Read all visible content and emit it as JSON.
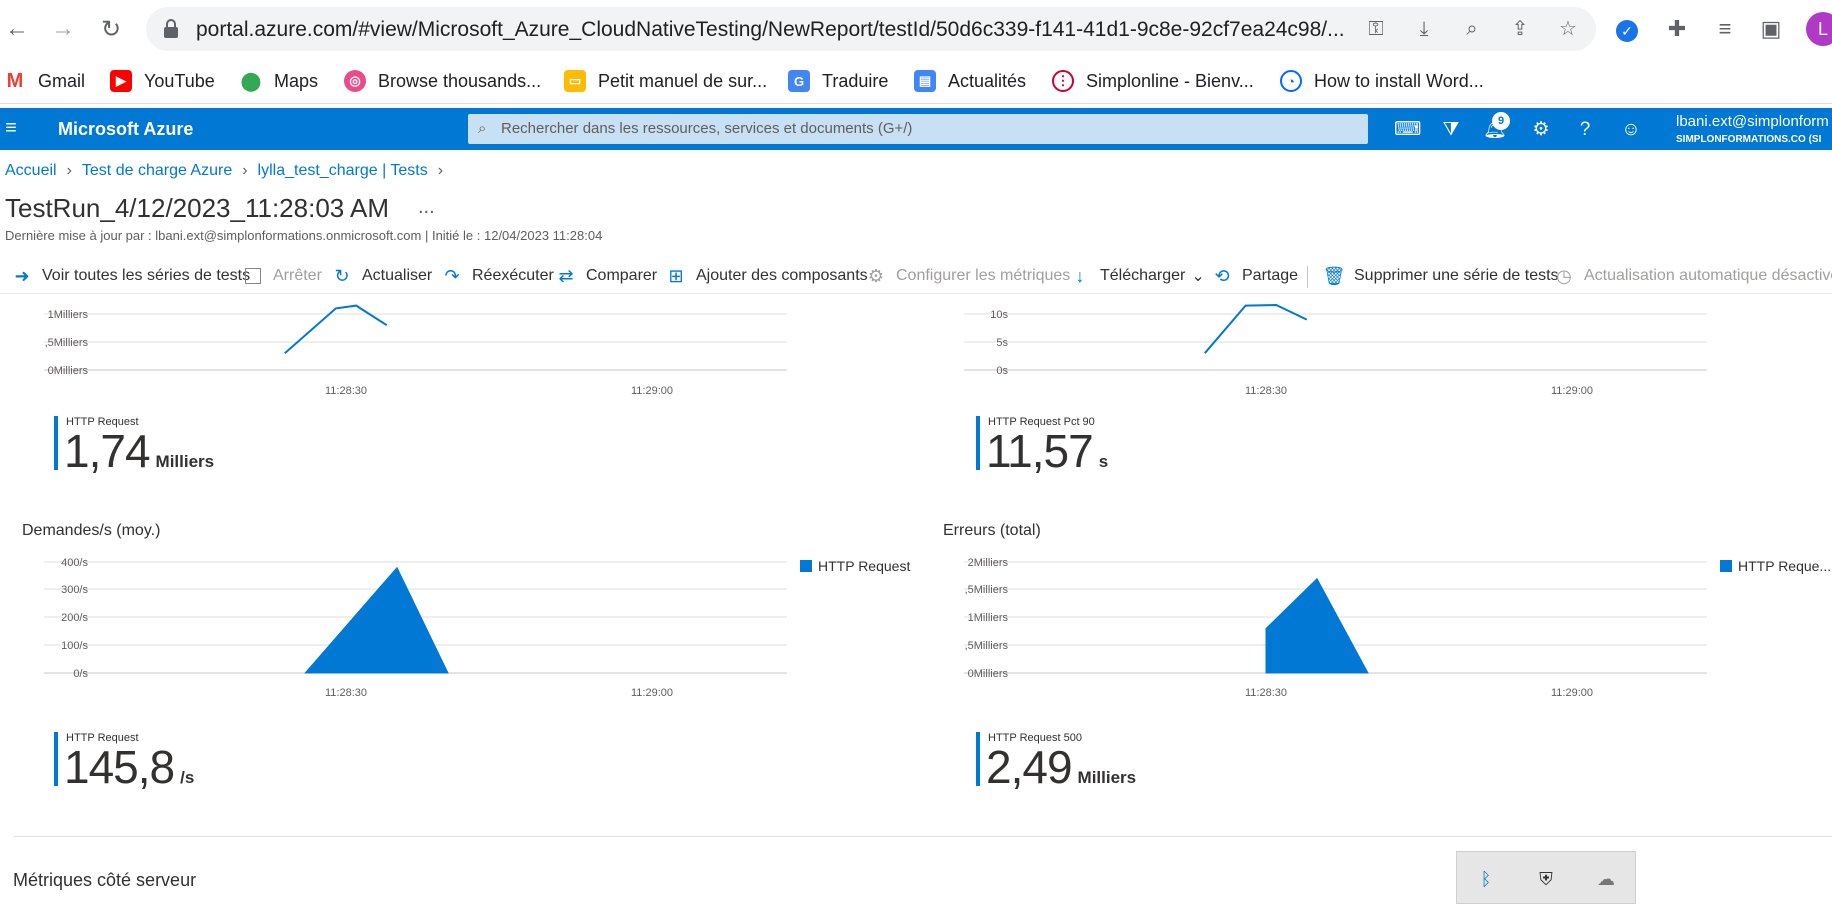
{
  "browser": {
    "url": "portal.azure.com/#view/Microsoft_Azure_CloudNativeTesting/NewReport/testId/50d6c339-f141-41d1-9c8e-92cf7ea24c98/...",
    "profile_initial": "L",
    "bookmarks": [
      "Gmail",
      "YouTube",
      "Maps",
      "Browse thousands...",
      "Petit manuel de sur...",
      "Traduire",
      "Actualités",
      "Simplonline - Bienv...",
      "How to install Word..."
    ]
  },
  "azure": {
    "title": "Microsoft Azure",
    "search_placeholder": "Rechercher dans les ressources, services et documents (G+/)",
    "notification_count": "9",
    "user_email": "lbani.ext@simplonform",
    "user_org": "SIMPLONFORMATIONS.CO (SI"
  },
  "breadcrumb": [
    "Accueil",
    "Test de charge Azure",
    "lylla_test_charge | Tests"
  ],
  "page": {
    "title": "TestRun_4/12/2023_11:28:03 AM",
    "more": "...",
    "subtitle": "Dernière mise à jour par : lbani.ext@simplonformations.onmicrosoft.com | Initié le : 12/04/2023 11:28:04"
  },
  "toolbar": {
    "view_all": "Voir toutes les séries de tests",
    "stop": "Arrêter",
    "refresh": "Actualiser",
    "rerun": "Réexécuter",
    "compare": "Comparer",
    "add_components": "Ajouter des composants",
    "configure_metrics": "Configurer les métriques",
    "download": "Télécharger",
    "share": "Partage",
    "delete": "Supprimer une série de tests",
    "auto_refresh": "Actualisation automatique désactivée"
  },
  "panels": {
    "top_left": {
      "kpi_label": "HTTP Request",
      "kpi_value": "1,74",
      "kpi_unit": "Milliers"
    },
    "top_right": {
      "kpi_label": "HTTP Request Pct 90",
      "kpi_value": "11,57",
      "kpi_unit": "s"
    },
    "bottom_left": {
      "title": "Demandes/s (moy.)",
      "legend": "HTTP Request",
      "kpi_label": "HTTP Request",
      "kpi_value": "145,8",
      "kpi_unit": "/s"
    },
    "bottom_right": {
      "title": "Erreurs (total)",
      "legend": "HTTP Reque...",
      "kpi_label": "HTTP Request 500",
      "kpi_value": "2,49",
      "kpi_unit": "Milliers"
    }
  },
  "chart_data": [
    {
      "type": "line",
      "ytick_labels": [
        "1Milliers",
        ",5Milliers",
        "0Milliers"
      ],
      "xtick_labels": [
        "11:28:30",
        "11:29:00"
      ],
      "series": [
        {
          "values": [
            {
              "x": "11:28:24",
              "y": 0.3
            },
            {
              "x": "11:28:29",
              "y": 1.1
            },
            {
              "x": "11:28:31",
              "y": 1.15
            },
            {
              "x": "11:28:34",
              "y": 0.8
            }
          ]
        }
      ]
    },
    {
      "type": "line",
      "ytick_labels": [
        "10s",
        "5s",
        "0s"
      ],
      "xtick_labels": [
        "11:28:30",
        "11:29:00"
      ],
      "series": [
        {
          "values": [
            {
              "x": "11:28:24",
              "y": 3
            },
            {
              "x": "11:28:28",
              "y": 11.5
            },
            {
              "x": "11:28:31",
              "y": 11.6
            },
            {
              "x": "11:28:34",
              "y": 9
            }
          ]
        }
      ]
    },
    {
      "type": "area",
      "title": "Demandes/s (moy.)",
      "ytick_labels": [
        "400/s",
        "300/s",
        "200/s",
        "100/s",
        "0/s"
      ],
      "xtick_labels": [
        "11:28:30",
        "11:29:00"
      ],
      "ylim": [
        0,
        400
      ],
      "legend": "top-right",
      "series": [
        {
          "name": "HTTP Request",
          "values": [
            {
              "x": "11:28:26",
              "y": 0
            },
            {
              "x": "11:28:35",
              "y": 380
            },
            {
              "x": "11:28:40",
              "y": 0
            }
          ]
        }
      ]
    },
    {
      "type": "area",
      "title": "Erreurs (total)",
      "ytick_labels": [
        "2Milliers",
        ",5Milliers",
        "1Milliers",
        ",5Milliers",
        "0Milliers"
      ],
      "xtick_labels": [
        "11:28:30",
        "11:29:00"
      ],
      "ylim": [
        0,
        2
      ],
      "legend": "top-right",
      "series": [
        {
          "name": "HTTP Reque...",
          "values": [
            {
              "x": "11:28:30",
              "y": 0
            },
            {
              "x": "11:28:30",
              "y": 0.8
            },
            {
              "x": "11:28:35",
              "y": 1.7
            },
            {
              "x": "11:28:40",
              "y": 0
            }
          ]
        }
      ]
    }
  ],
  "section": {
    "title": "Métriques côté serveur"
  }
}
